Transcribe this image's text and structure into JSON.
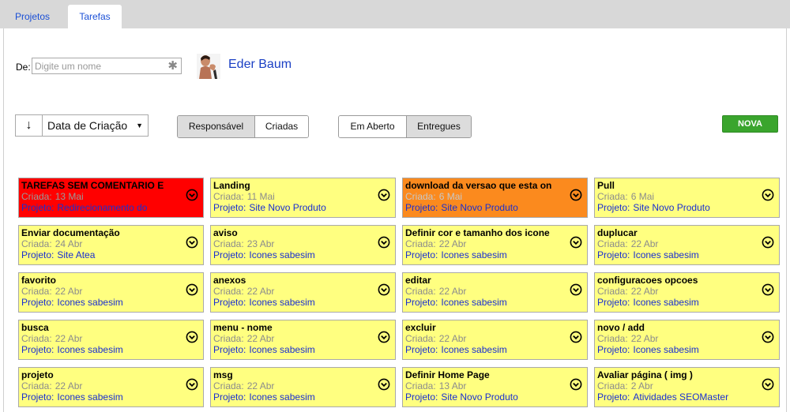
{
  "tabs": [
    {
      "label": "Projetos",
      "active": false
    },
    {
      "label": "Tarefas",
      "active": true
    }
  ],
  "filter": {
    "de_label": "De:",
    "name_placeholder": "Digite um nome",
    "clear_icon": "asterisk-clear-icon",
    "user_name": "Eder Baum"
  },
  "sort": {
    "arrow": "↓",
    "selected": "Data de Criação",
    "caret": "▼"
  },
  "segment_owner": {
    "responsavel": "Responsável",
    "criadas": "Criadas",
    "active": "responsavel"
  },
  "segment_status": {
    "em_aberto": "Em Aberto",
    "entregues": "Entregues",
    "active": "entregues"
  },
  "nova_label": "NOVA",
  "colors": {
    "yellow": "#ffff80",
    "red": "#ff0000",
    "orange": "#fb8a1e",
    "nova": "#3aa52d",
    "link": "#1a2fd0"
  },
  "created_label": "Criada:",
  "project_label": "Projeto:",
  "tasks": [
    {
      "title": "TAREFAS SEM COMENTARIO E",
      "created": "13 Mai",
      "project": "Redirecionamento  do",
      "color": "red"
    },
    {
      "title": "Landing",
      "created": "11 Mai",
      "project": "Site Novo Produto",
      "color": "yellow"
    },
    {
      "title": "download da versao que esta on",
      "created": "6 Mai",
      "project": "Site Novo Produto",
      "color": "orange"
    },
    {
      "title": "Pull",
      "created": "6 Mai",
      "project": "Site Novo Produto",
      "color": "yellow"
    },
    {
      "title": "Enviar documentação",
      "created": "24 Abr",
      "project": "Site Atea",
      "color": "yellow"
    },
    {
      "title": "aviso",
      "created": "23 Abr",
      "project": "Icones sabesim",
      "color": "yellow"
    },
    {
      "title": "Definir cor e tamanho dos icone",
      "created": "22 Abr",
      "project": "Icones sabesim",
      "color": "yellow"
    },
    {
      "title": "duplucar",
      "created": "22 Abr",
      "project": "Icones sabesim",
      "color": "yellow"
    },
    {
      "title": "favorito",
      "created": "22 Abr",
      "project": "Icones sabesim",
      "color": "yellow"
    },
    {
      "title": "anexos",
      "created": "22 Abr",
      "project": "Icones sabesim",
      "color": "yellow"
    },
    {
      "title": "editar",
      "created": "22 Abr",
      "project": "Icones sabesim",
      "color": "yellow"
    },
    {
      "title": "configuracoes opcoes",
      "created": "22 Abr",
      "project": "Icones sabesim",
      "color": "yellow"
    },
    {
      "title": "busca",
      "created": "22 Abr",
      "project": "Icones sabesim",
      "color": "yellow"
    },
    {
      "title": "menu - nome",
      "created": "22 Abr",
      "project": "Icones sabesim",
      "color": "yellow"
    },
    {
      "title": "excluir",
      "created": "22 Abr",
      "project": "Icones sabesim",
      "color": "yellow"
    },
    {
      "title": "novo / add",
      "created": "22 Abr",
      "project": "Icones sabesim",
      "color": "yellow"
    },
    {
      "title": "projeto",
      "created": "22 Abr",
      "project": "Icones sabesim",
      "color": "yellow"
    },
    {
      "title": "msg",
      "created": "22 Abr",
      "project": "Icones sabesim",
      "color": "yellow"
    },
    {
      "title": "Definir Home Page",
      "created": "13 Abr",
      "project": "Site Novo Produto",
      "color": "yellow"
    },
    {
      "title": "Avaliar página ( img )",
      "created": "2 Abr",
      "project": "Atividades SEOMaster",
      "color": "yellow"
    }
  ]
}
